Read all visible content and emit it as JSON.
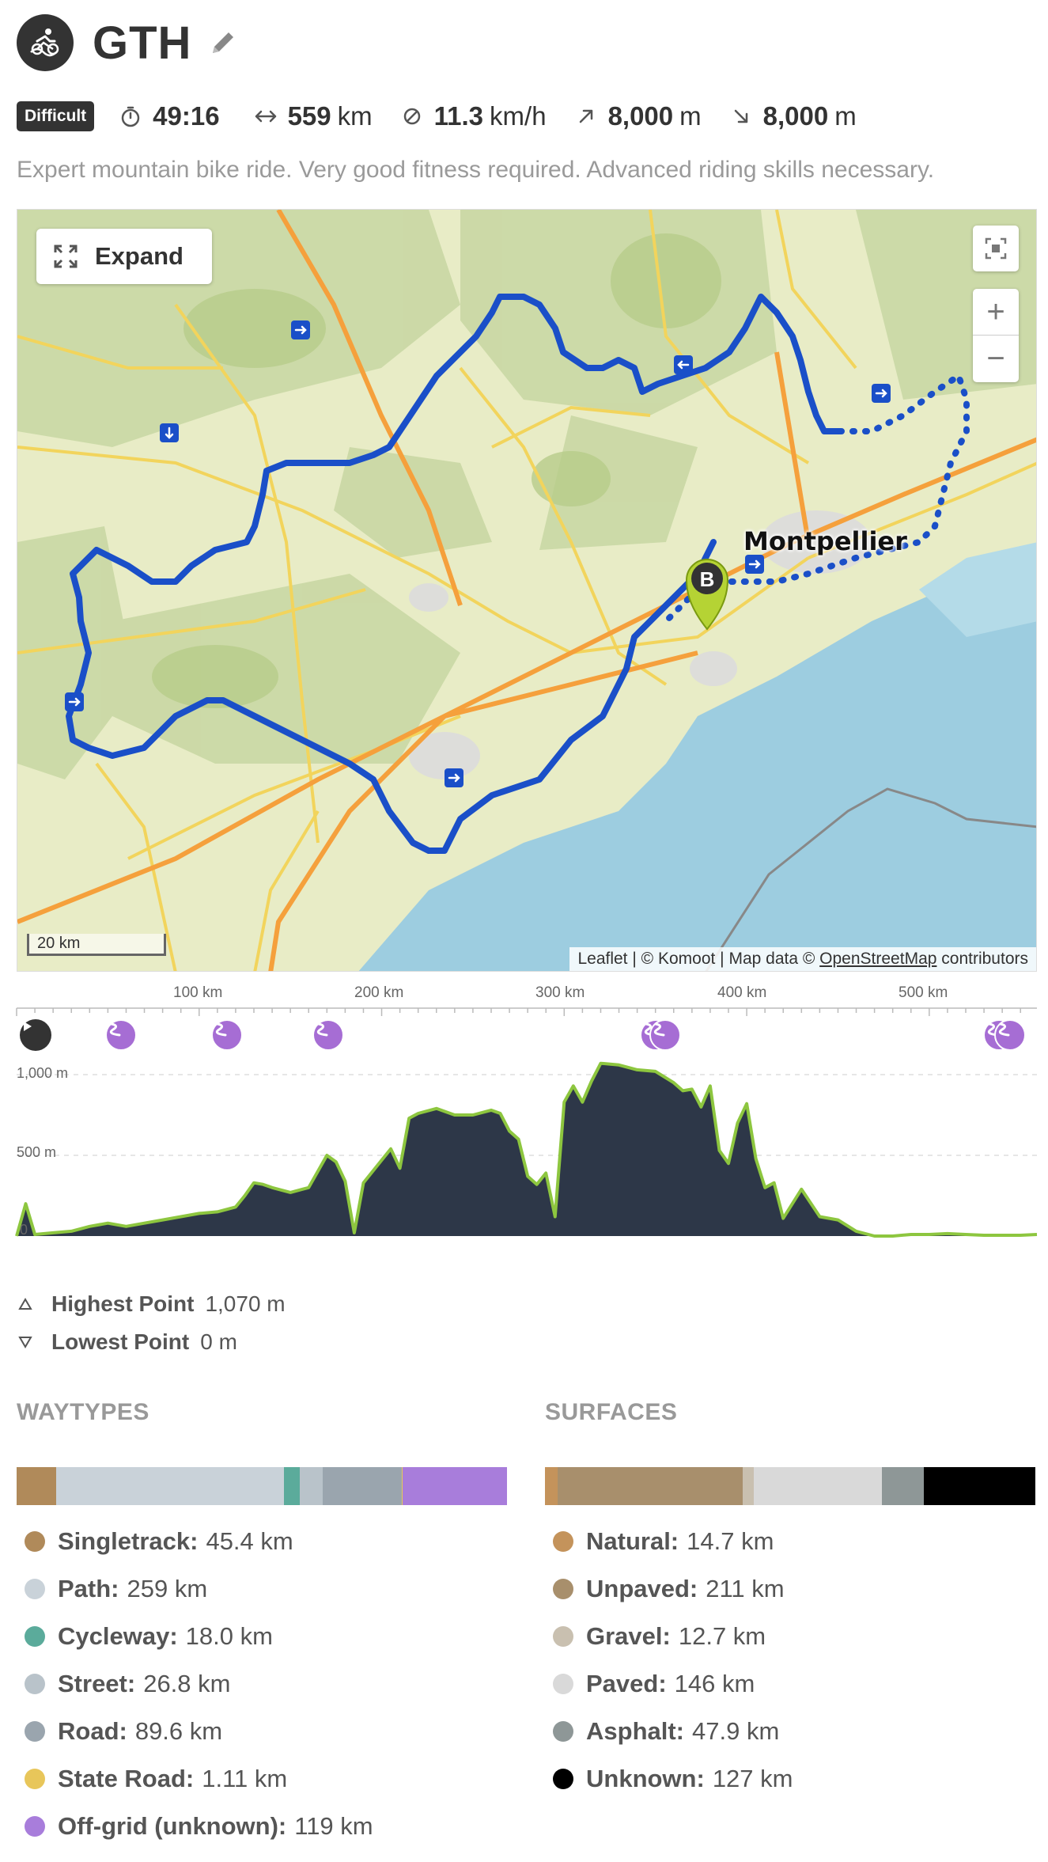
{
  "header": {
    "title": "GTH",
    "sport_icon": "mountain-bike-icon",
    "edit_icon": "pencil-icon"
  },
  "stats": {
    "difficulty": "Difficult",
    "duration": "49:16",
    "distance_value": "559",
    "distance_unit": "km",
    "speed_value": "11.3",
    "speed_unit": "km/h",
    "uphill_value": "8,000",
    "uphill_unit": "m",
    "downhill_value": "8,000",
    "downhill_unit": "m"
  },
  "description": "Expert mountain bike ride. Very good fitness required. Advanced riding skills necessary.",
  "map": {
    "expand_label": "Expand",
    "city": "Montpellier",
    "scale": "20 km",
    "zoom_in": "+",
    "zoom_out": "−",
    "waypoint_label": "B",
    "attribution": {
      "leaflet": "Leaflet",
      "sep1": " | © Komoot | Map data © ",
      "osm": "OpenStreetMap",
      "suffix": " contributors"
    },
    "colors": {
      "route": "#1a4fc8",
      "water": "#9dcde0",
      "land": "#e9edc9",
      "forest": "#c6d6a0",
      "road_major": "#f5a03c",
      "road_minor": "#f2d45c",
      "marker": "#b5d334"
    }
  },
  "elevation": {
    "km_ticks": [
      "100 km",
      "200 km",
      "300 km",
      "400 km",
      "500 km"
    ],
    "alt_ticks": [
      "1,000 m",
      "500 m",
      "0"
    ],
    "profile_km": [
      0,
      5,
      10,
      20,
      30,
      40,
      50,
      60,
      70,
      80,
      90,
      100,
      110,
      120,
      125,
      130,
      135,
      140,
      150,
      160,
      170,
      175,
      180,
      185,
      190,
      200,
      205,
      210,
      215,
      220,
      230,
      240,
      250,
      260,
      265,
      270,
      275,
      280,
      285,
      290,
      295,
      300,
      305,
      310,
      315,
      320,
      330,
      340,
      350,
      360,
      365,
      370,
      375,
      380,
      385,
      390,
      395,
      400,
      405,
      410,
      415,
      420,
      430,
      440,
      450,
      460,
      470,
      480,
      490,
      500,
      510,
      520,
      530,
      540,
      550,
      559
    ],
    "profile_m": [
      0,
      200,
      10,
      20,
      30,
      60,
      80,
      60,
      80,
      100,
      120,
      140,
      150,
      180,
      250,
      330,
      320,
      300,
      270,
      300,
      500,
      460,
      340,
      20,
      330,
      470,
      540,
      420,
      730,
      760,
      790,
      750,
      750,
      780,
      760,
      650,
      600,
      370,
      320,
      390,
      120,
      830,
      930,
      830,
      960,
      1070,
      1060,
      1030,
      1020,
      950,
      900,
      910,
      800,
      930,
      530,
      450,
      700,
      820,
      480,
      300,
      330,
      110,
      290,
      120,
      100,
      30,
      0,
      0,
      10,
      10,
      15,
      10,
      5,
      5,
      5,
      10
    ],
    "color_fill": "#2d3748",
    "color_line": "#8dc63f"
  },
  "extremes": {
    "highest_label": "Highest Point",
    "highest_value": "1,070 m",
    "lowest_label": "Lowest Point",
    "lowest_value": "0 m"
  },
  "waytypes": {
    "heading": "WAYTYPES",
    "items": [
      {
        "label": "Singletrack:",
        "value": "45.4 km",
        "km": 45.4,
        "color": "#b08a5a"
      },
      {
        "label": "Path:",
        "value": "259 km",
        "km": 259,
        "color": "#c9d2d9"
      },
      {
        "label": "Cycleway:",
        "value": "18.0 km",
        "km": 18.0,
        "color": "#5bab9b"
      },
      {
        "label": "Street:",
        "value": "26.8 km",
        "km": 26.8,
        "color": "#b9c3ca"
      },
      {
        "label": "Road:",
        "value": "89.6 km",
        "km": 89.6,
        "color": "#9aa5ae"
      },
      {
        "label": "State Road:",
        "value": "1.11 km",
        "km": 1.11,
        "color": "#e8c65a"
      },
      {
        "label": "Off-grid (unknown):",
        "value": "119 km",
        "km": 119,
        "color": "#a87ddb"
      }
    ]
  },
  "surfaces": {
    "heading": "SURFACES",
    "items": [
      {
        "label": "Natural:",
        "value": "14.7 km",
        "km": 14.7,
        "color": "#c4935b"
      },
      {
        "label": "Unpaved:",
        "value": "211 km",
        "km": 211,
        "color": "#a88f6c"
      },
      {
        "label": "Gravel:",
        "value": "12.7 km",
        "km": 12.7,
        "color": "#c9c0b0"
      },
      {
        "label": "Paved:",
        "value": "146 km",
        "km": 146,
        "color": "#d9d9d9"
      },
      {
        "label": "Asphalt:",
        "value": "47.9 km",
        "km": 47.9,
        "color": "#8e9797"
      },
      {
        "label": "Unknown:",
        "value": "127 km",
        "km": 127,
        "color": "#000000"
      }
    ]
  }
}
